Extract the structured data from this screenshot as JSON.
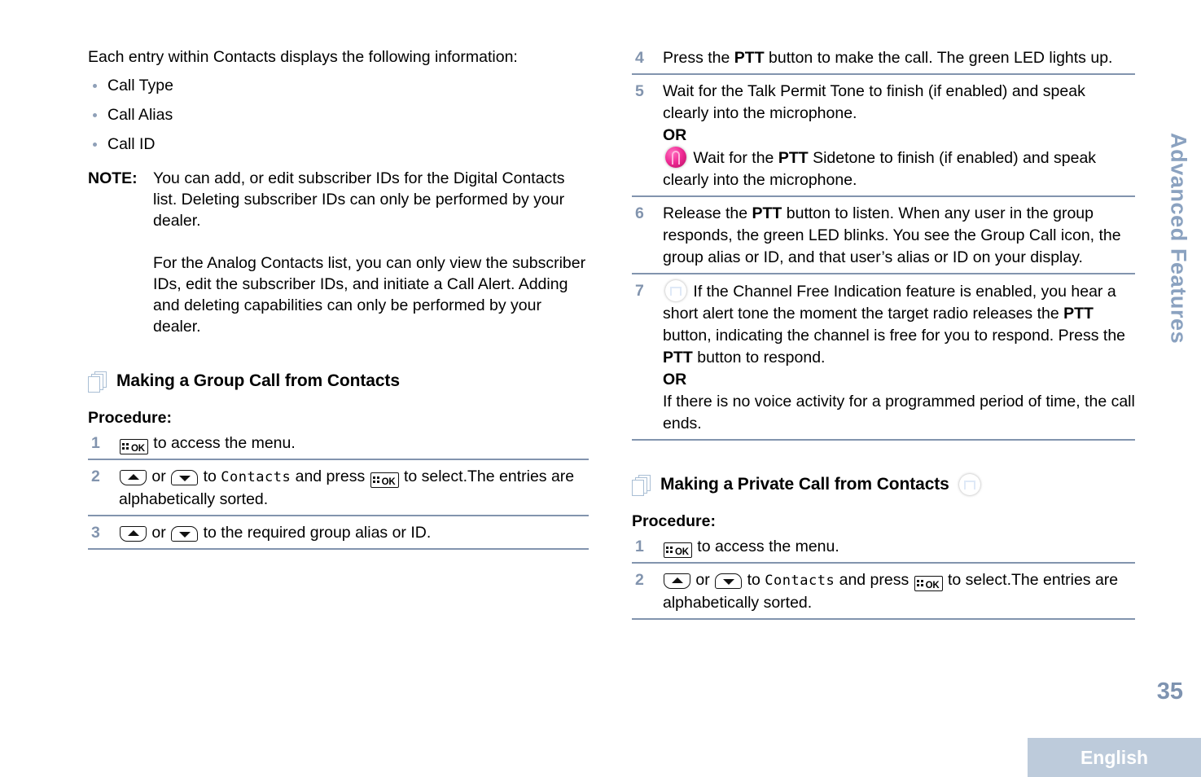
{
  "left_column": {
    "intro": "Each entry within Contacts displays the following information:",
    "bullets": [
      "Call Type",
      "Call Alias",
      "Call ID"
    ],
    "note": {
      "label": "NOTE:",
      "paragraphs": [
        "You can add, or edit subscriber IDs for the Digital Contacts list. Deleting subscriber IDs can only be performed by your dealer.",
        "For the Analog Contacts list, you can only view the subscriber IDs, edit the subscriber IDs, and initiate a Call Alert. Adding and deleting capabilities can only be performed by your dealer."
      ]
    },
    "section": {
      "title": "Making a Group Call from Contacts",
      "procedure_label": "Procedure:",
      "steps": [
        {
          "num": "1",
          "text_after_key": " to access the menu."
        },
        {
          "num": "2",
          "text_mid": " or ",
          "text_to": " to ",
          "menu_item": "Contacts",
          "text_press": " and press ",
          "text_tail": " to select.The entries are alphabetically sorted."
        },
        {
          "num": "3",
          "text_mid": " or ",
          "text_tail": " to the required group alias or ID."
        }
      ]
    }
  },
  "right_column": {
    "steps": [
      {
        "num": "4",
        "parts": [
          {
            "t": "Press the "
          },
          {
            "t": "PTT",
            "bold": true
          },
          {
            "t": " button to make the call. The green LED lights up."
          }
        ]
      },
      {
        "num": "5",
        "parts": [
          {
            "t": "Wait for the Talk Permit Tone to finish (if enabled) and speak clearly into the microphone."
          }
        ],
        "or_label": "OR",
        "or_icon": "ptt-sidetone-icon",
        "or_parts": [
          {
            "t": " Wait for the "
          },
          {
            "t": "PTT",
            "bold": true
          },
          {
            "t": " Sidetone to finish (if enabled) and speak clearly into the microphone."
          }
        ]
      },
      {
        "num": "6",
        "parts": [
          {
            "t": "Release the "
          },
          {
            "t": "PTT",
            "bold": true
          },
          {
            "t": " button to listen. When any user in the group responds, the green LED blinks. You see the Group Call icon, the group alias or ID, and that user’s alias or ID on your display."
          }
        ]
      },
      {
        "num": "7",
        "lead_icon": "channel-free-indication-icon",
        "parts": [
          {
            "t": " If the Channel Free Indication feature is enabled, you hear a short alert tone the moment the target radio releases the "
          },
          {
            "t": "PTT",
            "bold": true
          },
          {
            "t": " button, indicating the channel is free for you to respond. Press the "
          },
          {
            "t": "PTT",
            "bold": true
          },
          {
            "t": " button to respond."
          }
        ],
        "or_label": "OR",
        "or_parts": [
          {
            "t": "If there is no voice activity for a programmed period of time, the call ends."
          }
        ]
      }
    ],
    "section": {
      "title": "Making a Private Call from Contacts",
      "title_icon": "channel-free-indication-icon",
      "procedure_label": "Procedure:",
      "steps": [
        {
          "num": "1",
          "text_after_key": " to access the menu."
        },
        {
          "num": "2",
          "text_mid": " or ",
          "text_to": " to ",
          "menu_item": "Contacts",
          "text_press": " and press ",
          "text_tail": " to select.The entries are alphabetically sorted."
        }
      ]
    }
  },
  "side_tab": {
    "label": "Advanced Features"
  },
  "footer": {
    "page_number": "35",
    "language": "English"
  },
  "keys": {
    "ok_label": "OK"
  },
  "colors": {
    "accent_blue_gray": "#8294ae",
    "side_tab": "#8ba2c0",
    "page_number": "#7e93b0",
    "language_box": "#bdcbdb",
    "bullet": "#8fa0b8",
    "pages_icon_outline": "#a9bed4"
  }
}
